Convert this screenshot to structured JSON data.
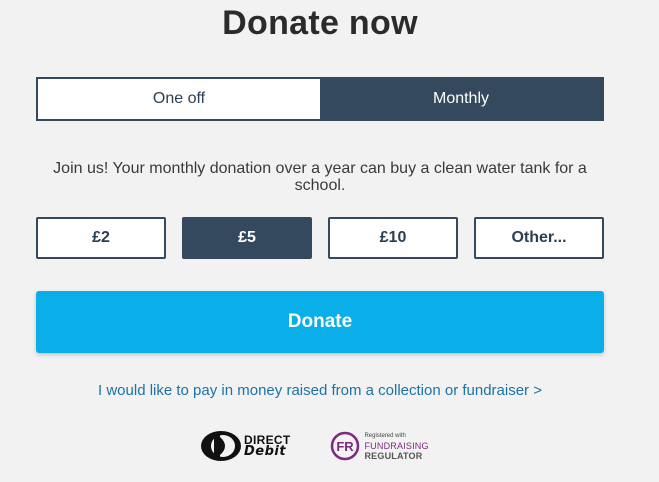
{
  "page": {
    "title": "Donate now"
  },
  "frequency": {
    "options": [
      {
        "label": "One off",
        "selected": false
      },
      {
        "label": "Monthly",
        "selected": true
      }
    ]
  },
  "message": "Join us! Your monthly donation over a year can buy a clean water tank for a school.",
  "amounts": [
    {
      "label": "£2",
      "selected": false
    },
    {
      "label": "£5",
      "selected": true
    },
    {
      "label": "£10",
      "selected": false
    },
    {
      "label": "Other...",
      "selected": false
    }
  ],
  "donate_button": "Donate",
  "fundraiser_link": "I would like to pay in money raised from a collection or fundraiser >",
  "logos": {
    "direct_debit": {
      "line1": "DIRECT",
      "line2": "Debit"
    },
    "fundraising_regulator": {
      "badge": "FR",
      "line1": "Registered with",
      "line2": "FUNDRAISING",
      "line3": "REGULATOR"
    }
  },
  "colors": {
    "navy": "#34495e",
    "accent_blue": "#0aaee9",
    "link": "#1c72a8",
    "fr_purple": "#7b2a80"
  }
}
